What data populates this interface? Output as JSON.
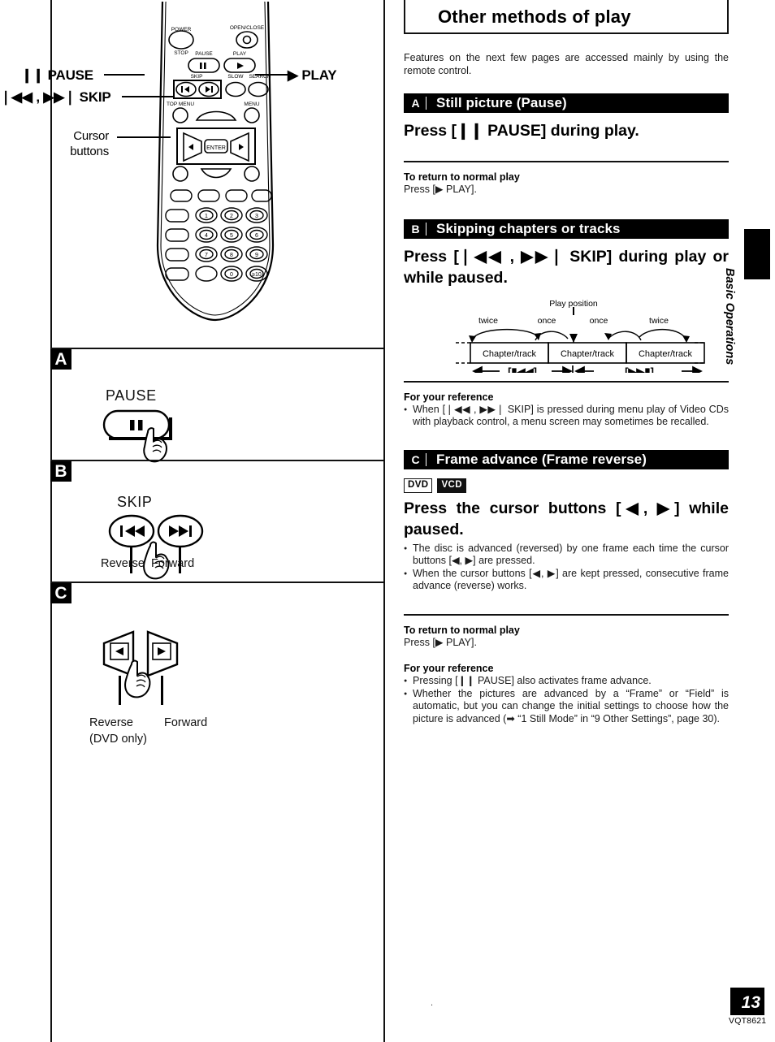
{
  "document": {
    "heading": "Other methods of play",
    "intro": "Features on the next few pages are accessed mainly by using the remote control.",
    "side_tab_label": "Basic Operations",
    "page_number": "13",
    "page_code": "VQT8621"
  },
  "remote_callouts": {
    "pause": "❙❙ PAUSE",
    "skip": "❘◀◀ ,  ▶▶❘ SKIP",
    "play": "▶ PLAY",
    "cursor": "Cursor buttons"
  },
  "panels": [
    {
      "letter": "A",
      "title": "PAUSE",
      "captions": []
    },
    {
      "letter": "B",
      "title": "SKIP",
      "captions": [
        "Reverse",
        "Forward"
      ]
    },
    {
      "letter": "C",
      "title": "",
      "captions": [
        "Reverse",
        "(DVD only)",
        "Forward"
      ]
    }
  ],
  "sections": [
    {
      "letter": "A",
      "title": "Still picture (Pause)",
      "instruction": "Press [❙❙ PAUSE] during play.",
      "return_head": "To return to normal play",
      "return_text": "Press [▶ PLAY]."
    },
    {
      "letter": "B",
      "title": "Skipping chapters or tracks",
      "instruction": "Press [❘◀◀ ,  ▶▶❘ SKIP] during play or while paused.",
      "reference_head": "For your reference",
      "reference_bullets": [
        "When [❘◀◀ , ▶▶❘ SKIP] is pressed during menu play of Video CDs with playback control, a menu screen may sometimes be recalled."
      ]
    },
    {
      "letter": "C",
      "title": "Frame advance (Frame reverse)",
      "disc_tags": [
        "DVD",
        "VCD"
      ],
      "instruction": "Press the cursor buttons [◀, ▶] while paused.",
      "bullets": [
        "The disc is advanced (reversed) by one frame each time the cursor buttons [◀, ▶] are pressed.",
        "When the cursor buttons [◀, ▶] are kept pressed, consecutive frame advance (reverse) works."
      ],
      "return_head": "To return to normal play",
      "return_text": "Press [▶ PLAY].",
      "reference_head": "For your reference",
      "reference_bullets": [
        "Pressing [❙❙ PAUSE] also activates frame advance.",
        "Whether the pictures are advanced by a “Frame” or “Field” is automatic, but you can change the initial settings to choose how the picture is advanced (➡ “1 Still Mode” in “9 Other Settings”, page 30)."
      ]
    }
  ],
  "skip_diagram": {
    "play_position_label": "Play position",
    "arc_labels": [
      "twice",
      "once",
      "once",
      "twice"
    ],
    "box_labels": [
      "Chapter/track",
      "Chapter/track",
      "Chapter/track"
    ],
    "left_button": "[ ❘◀◀ ]",
    "right_button": "[ ▶▶❘ ]"
  },
  "remote_keys": {
    "power": "POWER",
    "stop": "STOP",
    "open_close": "OPEN/CLOSE",
    "pause": "PAUSE",
    "play": "PLAY",
    "skip": "SKIP",
    "slow": "SLOW",
    "search": "SEARCH",
    "enter": "ENTER",
    "top_menu": "TOP MENU",
    "menu": "MENU",
    "numbers": [
      "1",
      "2",
      "3",
      "4",
      "5",
      "6",
      "7",
      "8",
      "9",
      "0",
      "≥10"
    ]
  }
}
